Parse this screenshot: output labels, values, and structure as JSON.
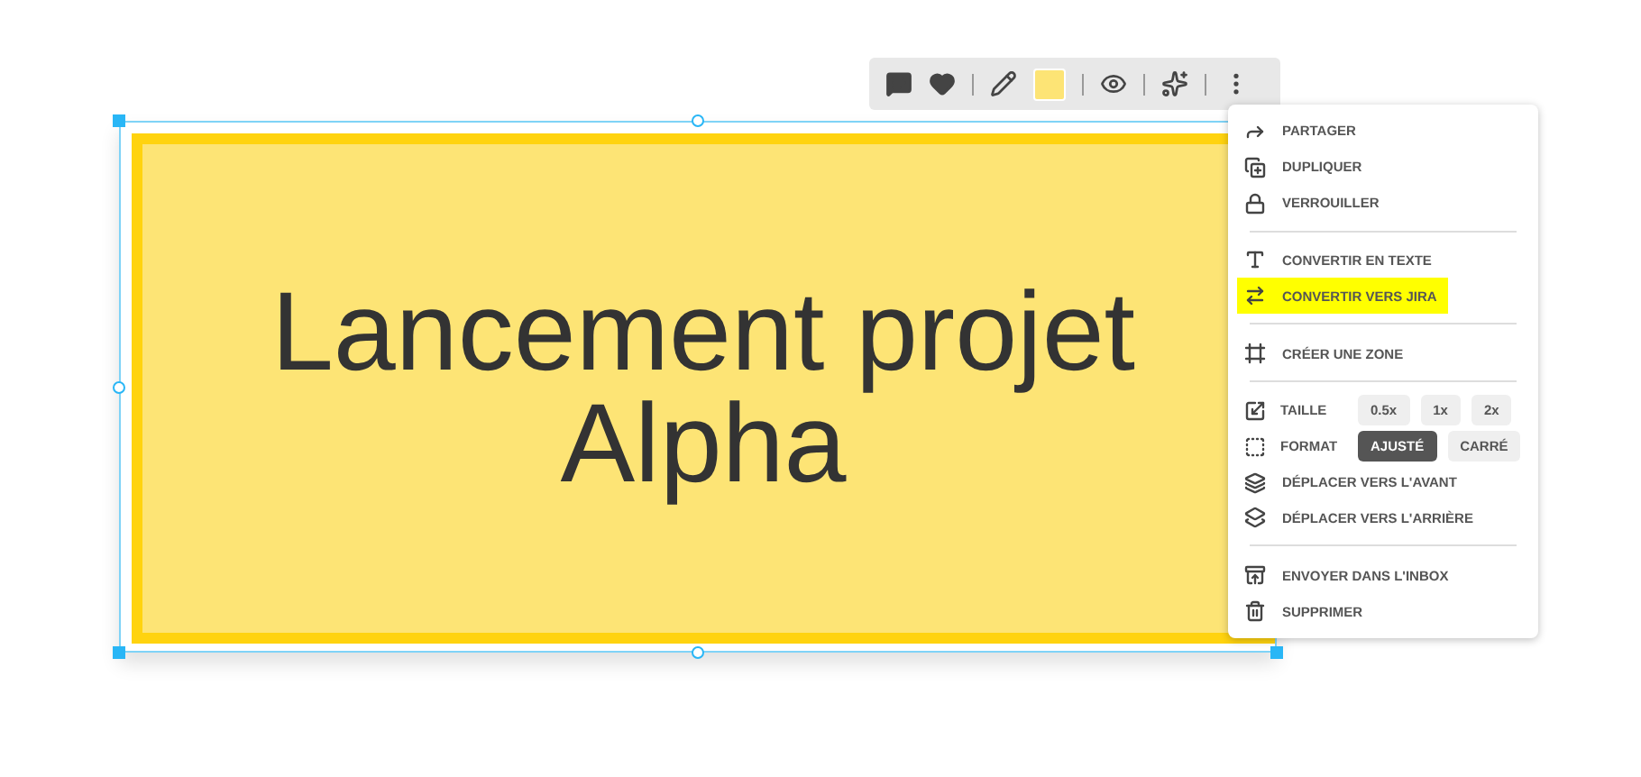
{
  "note": {
    "text": "Lancement projet Alpha",
    "color": "#fde475"
  },
  "toolbar": {
    "items": [
      {
        "kind": "comment"
      },
      {
        "kind": "heart"
      },
      {
        "kind": "divider"
      },
      {
        "kind": "pencil"
      },
      {
        "kind": "swatch",
        "color": "#fde475"
      },
      {
        "kind": "divider"
      },
      {
        "kind": "eye"
      },
      {
        "kind": "divider"
      },
      {
        "kind": "sparkles"
      },
      {
        "kind": "divider"
      },
      {
        "kind": "more"
      }
    ]
  },
  "menu": {
    "groups": [
      [
        {
          "kind": "action",
          "label": "PARTAGER",
          "highlighted": false
        },
        {
          "kind": "action",
          "label": "DUPLIQUER",
          "highlighted": false
        },
        {
          "kind": "action",
          "label": "VERROUILLER",
          "highlighted": false
        }
      ],
      [
        {
          "kind": "action",
          "label": "CONVERTIR EN TEXTE",
          "highlighted": false
        },
        {
          "kind": "action",
          "label": "CONVERTIR VERS JIRA",
          "highlighted": true
        }
      ],
      [
        {
          "kind": "action",
          "label": "CRÉER UNE ZONE",
          "highlighted": false
        }
      ],
      [
        {
          "kind": "options",
          "label": "TAILLE",
          "options": [
            {
              "label": "0.5x",
              "selected": false
            },
            {
              "label": "1x",
              "selected": false
            },
            {
              "label": "2x",
              "selected": false
            }
          ]
        },
        {
          "kind": "options",
          "label": "FORMAT",
          "options": [
            {
              "label": "AJUSTÉ",
              "selected": true
            },
            {
              "label": "CARRÉ",
              "selected": false
            }
          ]
        },
        {
          "kind": "action",
          "label": "DÉPLACER VERS L'AVANT",
          "highlighted": false
        },
        {
          "kind": "action",
          "label": "DÉPLACER VERS L'ARRIÈRE",
          "highlighted": false
        }
      ],
      [
        {
          "kind": "action",
          "label": "ENVOYER DANS L'INBOX",
          "highlighted": false
        },
        {
          "kind": "action",
          "label": "SUPPRIMER",
          "highlighted": false
        }
      ]
    ]
  }
}
